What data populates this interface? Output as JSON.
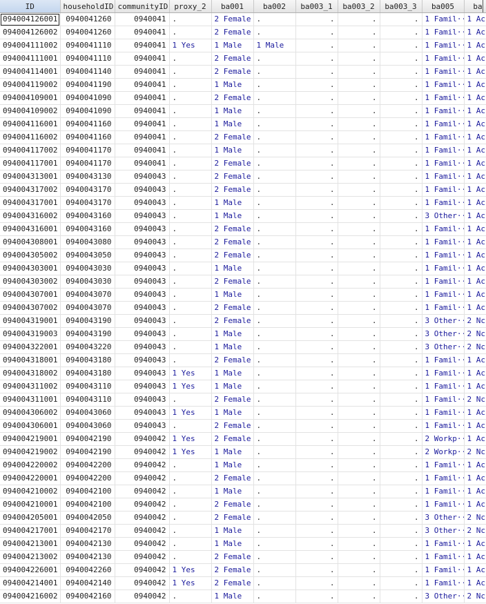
{
  "columns": [
    "ID",
    "householdID",
    "communityID",
    "proxy_2",
    "ba001",
    "ba002",
    "ba003_1",
    "ba003_2",
    "ba003_3",
    "ba005",
    "ba"
  ],
  "rows": [
    [
      "094004126001",
      "0940041260",
      "0940041",
      ".",
      "2 Female",
      ".",
      ".",
      ".",
      ".",
      "1 Famil···",
      "1 Ac"
    ],
    [
      "094004126002",
      "0940041260",
      "0940041",
      ".",
      "2 Female",
      ".",
      ".",
      ".",
      ".",
      "1 Famil···",
      "1 Ac"
    ],
    [
      "094004111002",
      "0940041110",
      "0940041",
      "1 Yes",
      "1 Male",
      "1 Male",
      ".",
      ".",
      ".",
      "1 Famil···",
      "1 Ac"
    ],
    [
      "094004111001",
      "0940041110",
      "0940041",
      ".",
      "2 Female",
      ".",
      ".",
      ".",
      ".",
      "1 Famil···",
      "1 Ac"
    ],
    [
      "094004114001",
      "0940041140",
      "0940041",
      ".",
      "2 Female",
      ".",
      ".",
      ".",
      ".",
      "1 Famil···",
      "1 Ac"
    ],
    [
      "094004119002",
      "0940041190",
      "0940041",
      ".",
      "1 Male",
      ".",
      ".",
      ".",
      ".",
      "1 Famil···",
      "1 Ac"
    ],
    [
      "094004109001",
      "0940041090",
      "0940041",
      ".",
      "2 Female",
      ".",
      ".",
      ".",
      ".",
      "1 Famil···",
      "1 Ac"
    ],
    [
      "094004109002",
      "0940041090",
      "0940041",
      ".",
      "1 Male",
      ".",
      ".",
      ".",
      ".",
      "1 Famil···",
      "1 Ac"
    ],
    [
      "094004116001",
      "0940041160",
      "0940041",
      ".",
      "1 Male",
      ".",
      ".",
      ".",
      ".",
      "1 Famil···",
      "1 Ac"
    ],
    [
      "094004116002",
      "0940041160",
      "0940041",
      ".",
      "2 Female",
      ".",
      ".",
      ".",
      ".",
      "1 Famil···",
      "1 Ac"
    ],
    [
      "094004117002",
      "0940041170",
      "0940041",
      ".",
      "1 Male",
      ".",
      ".",
      ".",
      ".",
      "1 Famil···",
      "1 Ac"
    ],
    [
      "094004117001",
      "0940041170",
      "0940041",
      ".",
      "2 Female",
      ".",
      ".",
      ".",
      ".",
      "1 Famil···",
      "1 Ac"
    ],
    [
      "094004313001",
      "0940043130",
      "0940043",
      ".",
      "2 Female",
      ".",
      ".",
      ".",
      ".",
      "1 Famil···",
      "1 Ac"
    ],
    [
      "094004317002",
      "0940043170",
      "0940043",
      ".",
      "2 Female",
      ".",
      ".",
      ".",
      ".",
      "1 Famil···",
      "1 Ac"
    ],
    [
      "094004317001",
      "0940043170",
      "0940043",
      ".",
      "1 Male",
      ".",
      ".",
      ".",
      ".",
      "1 Famil···",
      "1 Ac"
    ],
    [
      "094004316002",
      "0940043160",
      "0940043",
      ".",
      "1 Male",
      ".",
      ".",
      ".",
      ".",
      "3 Other···",
      "1 Ac"
    ],
    [
      "094004316001",
      "0940043160",
      "0940043",
      ".",
      "2 Female",
      ".",
      ".",
      ".",
      ".",
      "1 Famil···",
      "1 Ac"
    ],
    [
      "094004308001",
      "0940043080",
      "0940043",
      ".",
      "2 Female",
      ".",
      ".",
      ".",
      ".",
      "1 Famil···",
      "1 Ac"
    ],
    [
      "094004305002",
      "0940043050",
      "0940043",
      ".",
      "2 Female",
      ".",
      ".",
      ".",
      ".",
      "1 Famil···",
      "1 Ac"
    ],
    [
      "094004303001",
      "0940043030",
      "0940043",
      ".",
      "1 Male",
      ".",
      ".",
      ".",
      ".",
      "1 Famil···",
      "1 Ac"
    ],
    [
      "094004303002",
      "0940043030",
      "0940043",
      ".",
      "2 Female",
      ".",
      ".",
      ".",
      ".",
      "1 Famil···",
      "1 Ac"
    ],
    [
      "094004307001",
      "0940043070",
      "0940043",
      ".",
      "1 Male",
      ".",
      ".",
      ".",
      ".",
      "1 Famil···",
      "1 Ac"
    ],
    [
      "094004307002",
      "0940043070",
      "0940043",
      ".",
      "2 Female",
      ".",
      ".",
      ".",
      ".",
      "1 Famil···",
      "1 Ac"
    ],
    [
      "094004319001",
      "0940043190",
      "0940043",
      ".",
      "2 Female",
      ".",
      ".",
      ".",
      ".",
      "3 Other···",
      "2 Nc"
    ],
    [
      "094004319003",
      "0940043190",
      "0940043",
      ".",
      "1 Male",
      ".",
      ".",
      ".",
      ".",
      "3 Other···",
      "2 Nc"
    ],
    [
      "094004322001",
      "0940043220",
      "0940043",
      ".",
      "1 Male",
      ".",
      ".",
      ".",
      ".",
      "3 Other···",
      "2 Nc"
    ],
    [
      "094004318001",
      "0940043180",
      "0940043",
      ".",
      "2 Female",
      ".",
      ".",
      ".",
      ".",
      "1 Famil···",
      "1 Ac"
    ],
    [
      "094004318002",
      "0940043180",
      "0940043",
      "1 Yes",
      "1 Male",
      ".",
      ".",
      ".",
      ".",
      "1 Famil···",
      "1 Ac"
    ],
    [
      "094004311002",
      "0940043110",
      "0940043",
      "1 Yes",
      "1 Male",
      ".",
      ".",
      ".",
      ".",
      "1 Famil···",
      "1 Ac"
    ],
    [
      "094004311001",
      "0940043110",
      "0940043",
      ".",
      "2 Female",
      ".",
      ".",
      ".",
      ".",
      "1 Famil···",
      "2 Nc"
    ],
    [
      "094004306002",
      "0940043060",
      "0940043",
      "1 Yes",
      "1 Male",
      ".",
      ".",
      ".",
      ".",
      "1 Famil···",
      "1 Ac"
    ],
    [
      "094004306001",
      "0940043060",
      "0940043",
      ".",
      "2 Female",
      ".",
      ".",
      ".",
      ".",
      "1 Famil···",
      "1 Ac"
    ],
    [
      "094004219001",
      "0940042190",
      "0940042",
      "1 Yes",
      "2 Female",
      ".",
      ".",
      ".",
      ".",
      "2 Workp···",
      "1 Ac"
    ],
    [
      "094004219002",
      "0940042190",
      "0940042",
      "1 Yes",
      "1 Male",
      ".",
      ".",
      ".",
      ".",
      "2 Workp···",
      "2 Nc"
    ],
    [
      "094004220002",
      "0940042200",
      "0940042",
      ".",
      "1 Male",
      ".",
      ".",
      ".",
      ".",
      "1 Famil···",
      "1 Ac"
    ],
    [
      "094004220001",
      "0940042200",
      "0940042",
      ".",
      "2 Female",
      ".",
      ".",
      ".",
      ".",
      "1 Famil···",
      "1 Ac"
    ],
    [
      "094004210002",
      "0940042100",
      "0940042",
      ".",
      "1 Male",
      ".",
      ".",
      ".",
      ".",
      "1 Famil···",
      "1 Ac"
    ],
    [
      "094004210001",
      "0940042100",
      "0940042",
      ".",
      "2 Female",
      ".",
      ".",
      ".",
      ".",
      "1 Famil···",
      "1 Ac"
    ],
    [
      "094004205001",
      "0940042050",
      "0940042",
      ".",
      "2 Female",
      ".",
      ".",
      ".",
      ".",
      "3 Other···",
      "2 Nc"
    ],
    [
      "094004217001",
      "0940042170",
      "0940042",
      ".",
      "1 Male",
      ".",
      ".",
      ".",
      ".",
      "3 Other···",
      "2 Nc"
    ],
    [
      "094004213001",
      "0940042130",
      "0940042",
      ".",
      "1 Male",
      ".",
      ".",
      ".",
      ".",
      "1 Famil···",
      "1 Ac"
    ],
    [
      "094004213002",
      "0940042130",
      "0940042",
      ".",
      "2 Female",
      ".",
      ".",
      ".",
      ".",
      "1 Famil···",
      "1 Ac"
    ],
    [
      "094004226001",
      "0940042260",
      "0940042",
      "1 Yes",
      "2 Female",
      ".",
      ".",
      ".",
      ".",
      "1 Famil···",
      "1 Ac"
    ],
    [
      "094004214001",
      "0940042140",
      "0940042",
      "1 Yes",
      "2 Female",
      ".",
      ".",
      ".",
      ".",
      "1 Famil···",
      "1 Ac"
    ],
    [
      "094004216002",
      "0940042160",
      "0940042",
      ".",
      "1 Male",
      ".",
      ".",
      ".",
      ".",
      "3 Other···",
      "2 Nc"
    ]
  ]
}
